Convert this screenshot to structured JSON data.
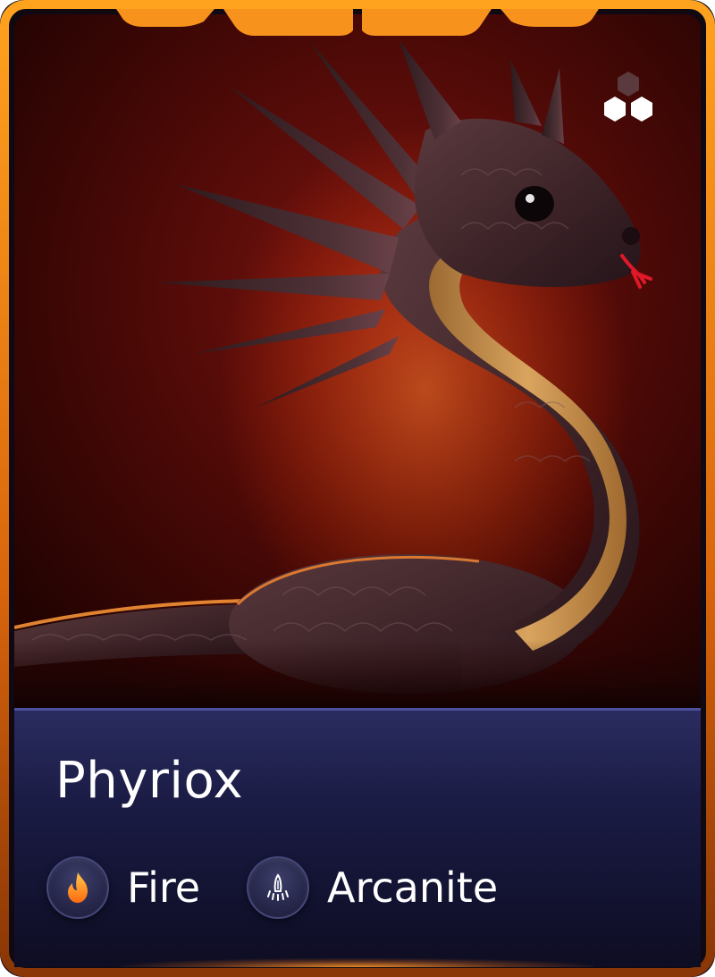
{
  "card": {
    "name": "Phyriox",
    "attributes": [
      {
        "label": "Fire",
        "icon": "fire-icon"
      },
      {
        "label": "Arcanite",
        "icon": "arcanite-icon"
      }
    ],
    "rarity_icon": "hexagon-cluster-icon",
    "colors": {
      "frame": "#f5901c",
      "background": "#6b0d0c",
      "panel": "#1b1c45",
      "accent": "#ff8a1c"
    }
  }
}
